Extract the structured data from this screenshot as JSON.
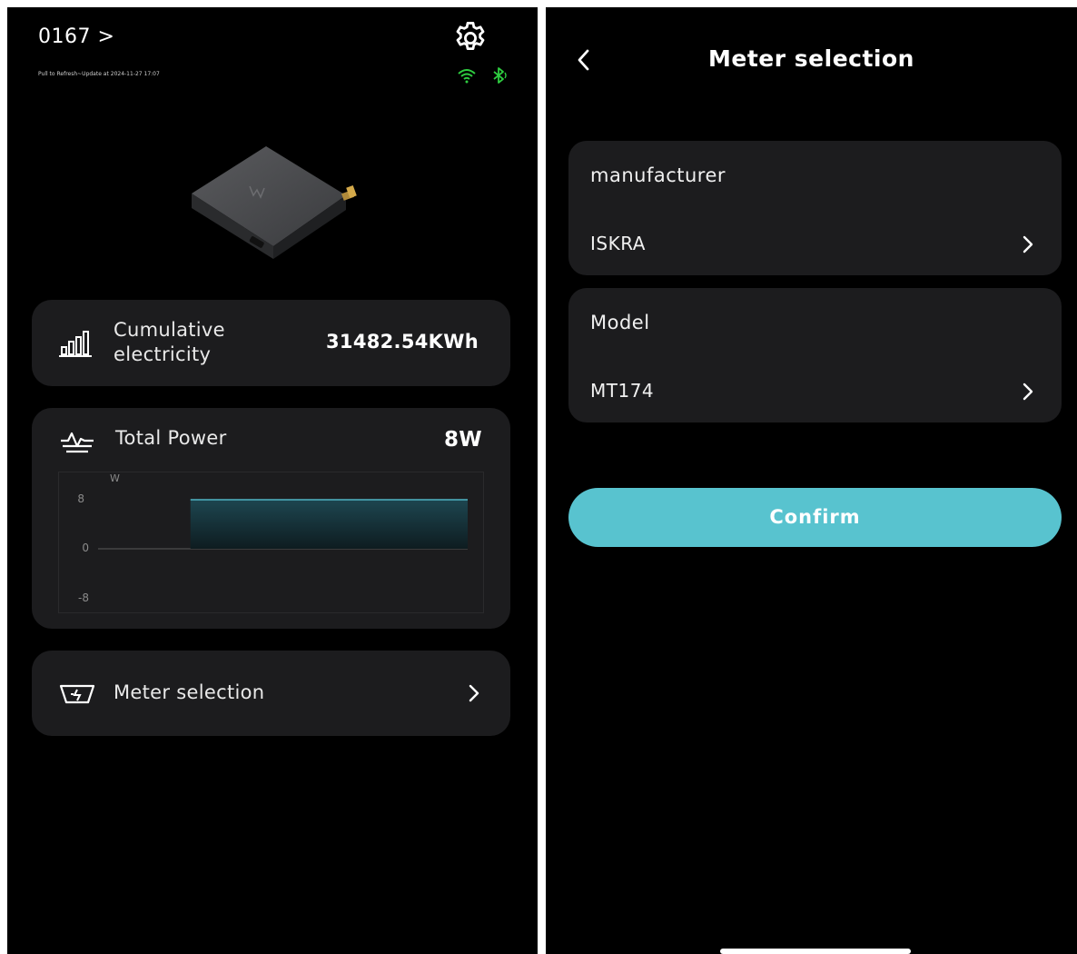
{
  "left_screen": {
    "device_name": "0167  >",
    "refresh_text": "Pull to Refresh~Update at 2024-11-27 17:07",
    "icons": {
      "settings": "gear-icon",
      "wifi": "wifi-icon",
      "bluetooth": "bluetooth-icon",
      "status_color": "#2ecc40"
    },
    "cumulative": {
      "label": "Cumulative electricity",
      "value": "31482.54KWh",
      "icon": "bar-chart-icon"
    },
    "power": {
      "label": "Total Power",
      "value": "8W",
      "icon": "pulse-icon"
    },
    "meter_row": {
      "label": "Meter selection",
      "icon": "meter-icon"
    }
  },
  "chart_data": {
    "type": "area",
    "title": "",
    "xlabel": "",
    "ylabel": "W",
    "yticks": [
      "8",
      "0",
      "-8"
    ],
    "ylim": [
      -8,
      8
    ],
    "x": [
      0.25,
      1.0
    ],
    "values": [
      8,
      8
    ],
    "color": "#4fb3c4",
    "grid": false
  },
  "right_screen": {
    "title": "Meter selection",
    "manufacturer": {
      "label": "manufacturer",
      "value": "ISKRA"
    },
    "model": {
      "label": "Model",
      "value": "MT174"
    },
    "confirm_label": "Confirm",
    "accent": "#58c3cf"
  }
}
